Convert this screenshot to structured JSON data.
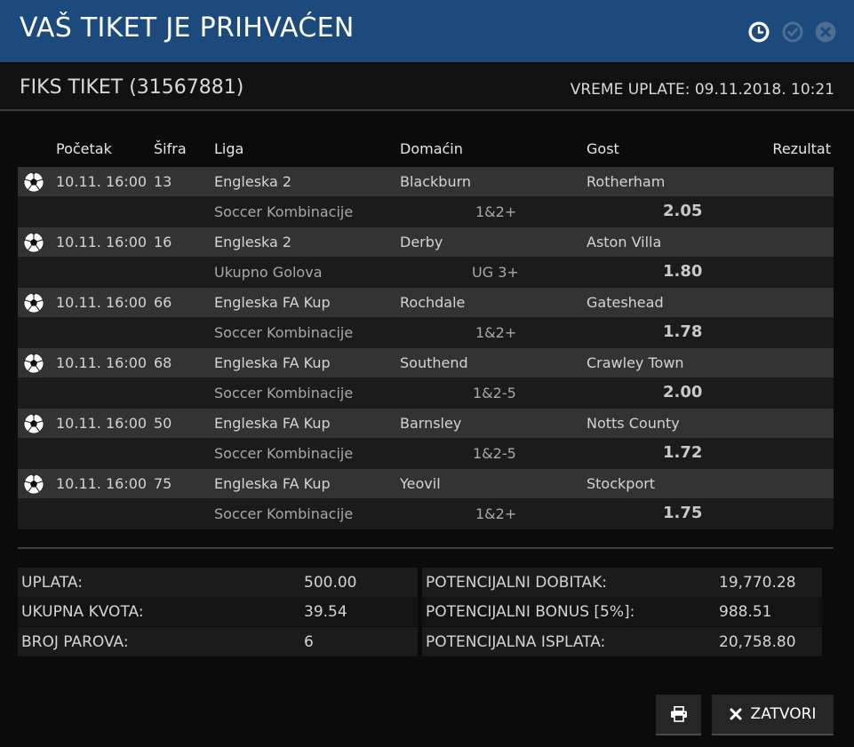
{
  "header": {
    "title": "VAŠ TIKET JE PRIHVAĆEN"
  },
  "ticket": {
    "title": "FIKS TIKET (31567881)",
    "time_label": "VREME UPLATE:",
    "time_value": "09.11.2018. 10:21"
  },
  "table": {
    "headers": {
      "start": "Početak",
      "code": "Šifra",
      "league": "Liga",
      "home": "Domaćin",
      "away": "Gost",
      "result": "Rezultat"
    },
    "matches": [
      {
        "start": "10.11. 16:00",
        "code": "13",
        "league": "Engleska 2",
        "home": "Blackburn",
        "away": "Rotherham",
        "bet_type": "Soccer Kombinacije",
        "tip": "1&2+",
        "odd": "2.05"
      },
      {
        "start": "10.11. 16:00",
        "code": "16",
        "league": "Engleska 2",
        "home": "Derby",
        "away": "Aston Villa",
        "bet_type": "Ukupno Golova",
        "tip": "UG 3+",
        "odd": "1.80"
      },
      {
        "start": "10.11. 16:00",
        "code": "66",
        "league": "Engleska FA Kup",
        "home": "Rochdale",
        "away": "Gateshead",
        "bet_type": "Soccer Kombinacije",
        "tip": "1&2+",
        "odd": "1.78"
      },
      {
        "start": "10.11. 16:00",
        "code": "68",
        "league": "Engleska FA Kup",
        "home": "Southend",
        "away": "Crawley Town",
        "bet_type": "Soccer Kombinacije",
        "tip": "1&2-5",
        "odd": "2.00"
      },
      {
        "start": "10.11. 16:00",
        "code": "50",
        "league": "Engleska FA Kup",
        "home": "Barnsley",
        "away": "Notts County",
        "bet_type": "Soccer Kombinacije",
        "tip": "1&2-5",
        "odd": "1.72"
      },
      {
        "start": "10.11. 16:00",
        "code": "75",
        "league": "Engleska FA Kup",
        "home": "Yeovil",
        "away": "Stockport",
        "bet_type": "Soccer Kombinacije",
        "tip": "1&2+",
        "odd": "1.75"
      }
    ]
  },
  "summary": {
    "left": [
      {
        "label": "UPLATA:",
        "value": "500.00"
      },
      {
        "label": "UKUPNA KVOTA:",
        "value": "39.54"
      },
      {
        "label": "BROJ PAROVA:",
        "value": "6"
      }
    ],
    "right": [
      {
        "label": "POTENCIJALNI DOBITAK:",
        "value": "19,770.28"
      },
      {
        "label": "POTENCIJALNI BONUS [5%]:",
        "value": "988.51"
      },
      {
        "label": "POTENCIJALNA ISPLATA:",
        "value": "20,758.80"
      }
    ]
  },
  "buttons": {
    "close_label": "ZATVORI"
  },
  "icons": {
    "header": [
      "clock-icon",
      "check-circle-icon",
      "close-circle-icon"
    ],
    "row": "soccer-ball-icon",
    "print": "printer-icon",
    "close": "x-icon"
  },
  "colors": {
    "header_bg": "#1d4a7c",
    "row_top": "#333333",
    "row_bottom": "#1b1b1b",
    "background": "#0b0b0b"
  }
}
